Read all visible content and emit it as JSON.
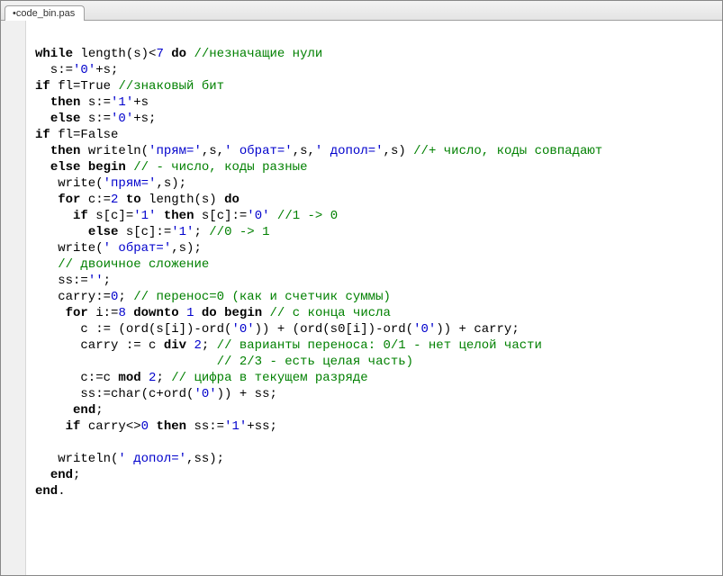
{
  "tab": {
    "label": "•code_bin.pas"
  },
  "code": {
    "l01": {
      "a": "while",
      "b": " length(s)<",
      "c": "7",
      "d": " ",
      "e": "do",
      "f": " ",
      "g": "//незначащие нули"
    },
    "l02": {
      "a": "  s:=",
      "b": "'0'",
      "c": "+s;"
    },
    "l03": {
      "a": "if",
      "b": " fl=True ",
      "c": "//знаковый бит"
    },
    "l04": {
      "a": "  ",
      "b": "then",
      "c": " s:=",
      "d": "'1'",
      "e": "+s"
    },
    "l05": {
      "a": "  ",
      "b": "else",
      "c": " s:=",
      "d": "'0'",
      "e": "+s;"
    },
    "l06": {
      "a": "if",
      "b": " fl=False"
    },
    "l07": {
      "a": "  ",
      "b": "then",
      "c": " writeln(",
      "d": "'прям='",
      "e": ",s,",
      "f": "' обрат='",
      "g": ",s,",
      "h": "' допол='",
      "i": ",s) ",
      "j": "//+ число, коды совпадают"
    },
    "l08": {
      "a": "  ",
      "b": "else",
      "c": " ",
      "d": "begin",
      "e": " ",
      "f": "// - число, коды разные"
    },
    "l09": {
      "a": "   write(",
      "b": "'прям='",
      "c": ",s);"
    },
    "l10": {
      "a": "   ",
      "b": "for",
      "c": " c:=",
      "d": "2",
      "e": " ",
      "f": "to",
      "g": " length(s) ",
      "h": "do"
    },
    "l11": {
      "a": "     ",
      "b": "if",
      "c": " s[c]=",
      "d": "'1'",
      "e": " ",
      "f": "then",
      "g": " s[c]:=",
      "h": "'0'",
      "i": " ",
      "j": "//1 -> 0"
    },
    "l12": {
      "a": "       ",
      "b": "else",
      "c": " s[c]:=",
      "d": "'1'",
      "e": "; ",
      "f": "//0 -> 1"
    },
    "l13": {
      "a": "   write(",
      "b": "' обрат='",
      "c": ",s);"
    },
    "l14": {
      "a": "   ",
      "b": "// двоичное сложение"
    },
    "l15": {
      "a": "   ss:=",
      "b": "''",
      "c": ";"
    },
    "l16": {
      "a": "   carry:=",
      "b": "0",
      "c": "; ",
      "d": "// перенос=0 (как и счетчик суммы)"
    },
    "l17": {
      "a": "    ",
      "b": "for",
      "c": " i:=",
      "d": "8",
      "e": " ",
      "f": "downto",
      "g": " ",
      "h": "1",
      "i": " ",
      "j": "do",
      "k": " ",
      "l": "begin",
      "m": " ",
      "n": "// с конца числа"
    },
    "l18": {
      "a": "      c := (ord(s[i])-ord(",
      "b": "'0'",
      "c": ")) + (ord(s0[i])-ord(",
      "d": "'0'",
      "e": ")) + carry;"
    },
    "l19": {
      "a": "      carry := c ",
      "b": "div",
      "c": " ",
      "d": "2",
      "e": "; ",
      "f": "// варианты переноса: 0/1 - нет целой части"
    },
    "l20": {
      "a": "                        ",
      "b": "// 2/3 - есть целая часть)"
    },
    "l21": {
      "a": "      c:=c ",
      "b": "mod",
      "c": " ",
      "d": "2",
      "e": "; ",
      "f": "// цифра в текущем разряде"
    },
    "l22": {
      "a": "      ss:=char(c+ord(",
      "b": "'0'",
      "c": ")) + ss;"
    },
    "l23": {
      "a": "     ",
      "b": "end",
      "c": ";"
    },
    "l24": {
      "a": "    ",
      "b": "if",
      "c": " carry<>",
      "d": "0",
      "e": " ",
      "f": "then",
      "g": " ss:=",
      "h": "'1'",
      "i": "+ss;"
    },
    "l25": "",
    "l26": {
      "a": "   writeln(",
      "b": "' допол='",
      "c": ",ss);"
    },
    "l27": {
      "a": "  ",
      "b": "end",
      "c": ";"
    },
    "l28": {
      "a": "end",
      "b": "."
    }
  }
}
